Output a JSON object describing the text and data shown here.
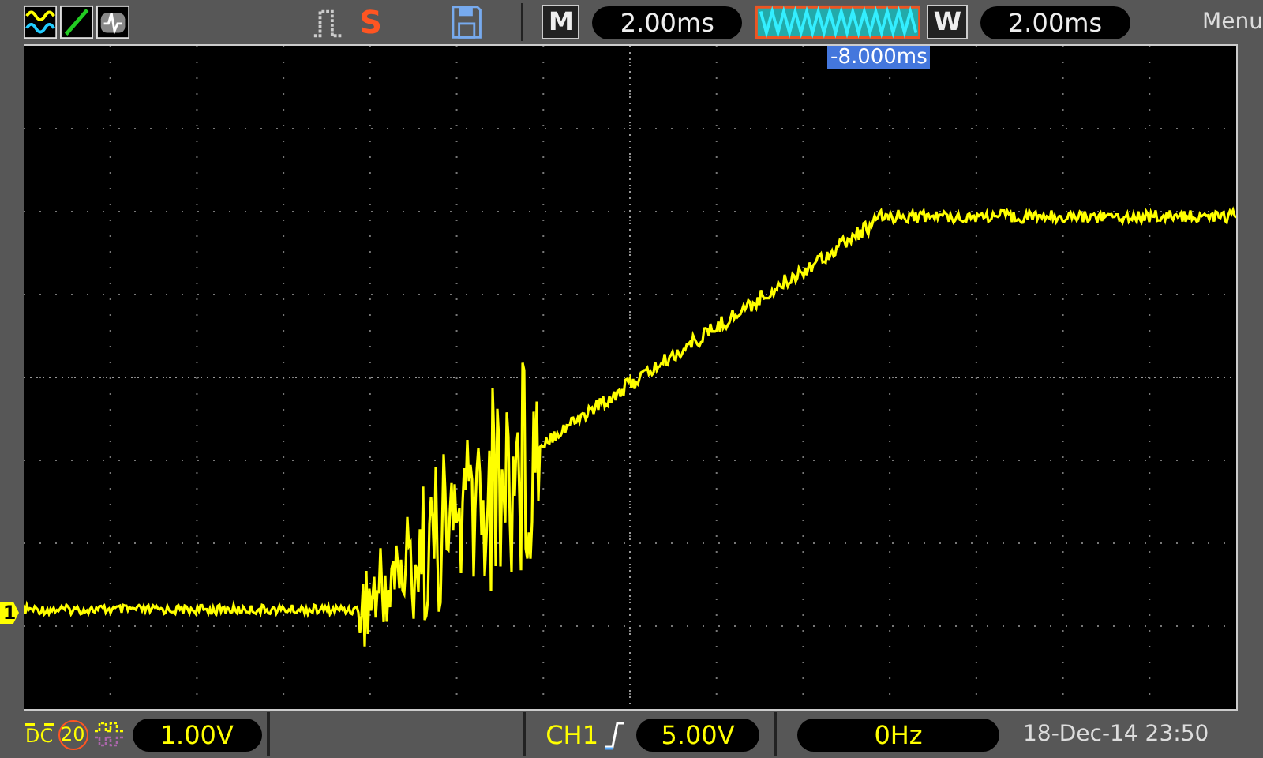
{
  "top_bar": {
    "run_state": "S",
    "timebase": {
      "label": "M",
      "value": "2.00ms"
    },
    "window": {
      "label": "W",
      "value": "2.00ms"
    },
    "menu": "Menu"
  },
  "screen": {
    "trigger_offset": "-8.000ms",
    "channel_marker": "1"
  },
  "bottom_bar": {
    "coupling": "DC",
    "bandwidth_limit": "20",
    "volts_per_div": "1.00V",
    "trigger_source": "CH1",
    "trigger_level": "5.00V",
    "frequency": "0Hz",
    "datetime": "18-Dec-14 23:50"
  }
}
